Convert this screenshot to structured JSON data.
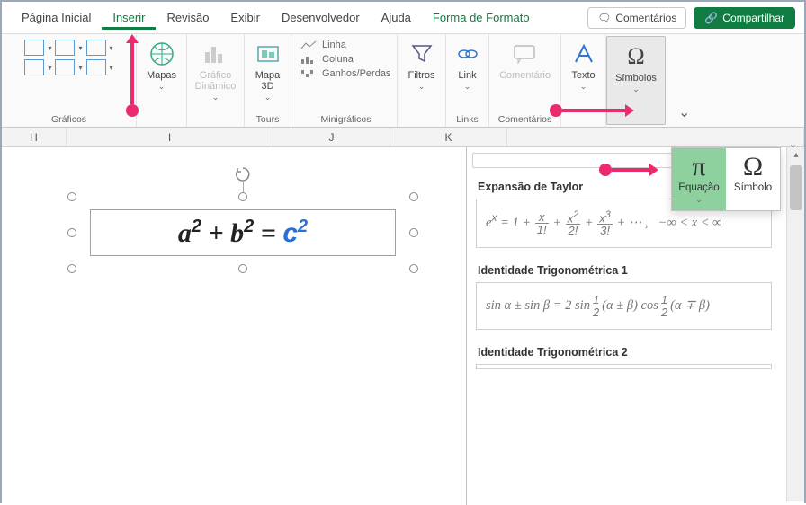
{
  "tabs": {
    "home": "Página Inicial",
    "insert": "Inserir",
    "review": "Revisão",
    "view": "Exibir",
    "developer": "Desenvolvedor",
    "help": "Ajuda",
    "format": "Forma de Formato",
    "comments_btn": "Comentários",
    "share_btn": "Compartilhar"
  },
  "ribbon": {
    "maps": "Mapas",
    "pivot_chart": "Gráfico Dinâmico",
    "map_3d": "Mapa 3D",
    "spark_line": "Linha",
    "spark_col": "Coluna",
    "spark_winloss": "Ganhos/Perdas",
    "filters": "Filtros",
    "link": "Link",
    "comment": "Comentário",
    "text": "Texto",
    "symbols": "Símbolos",
    "g_charts": "Gráficos",
    "g_tours": "Tours",
    "g_spark": "Minigráficos",
    "g_links": "Links",
    "g_comments": "Comentários"
  },
  "popover": {
    "equation": "Equação",
    "symbol": "Símbolo"
  },
  "columns": {
    "h": "H",
    "i": "I",
    "j": "J",
    "k": "K"
  },
  "gallery": {
    "taylor_title": "Expansão de Taylor",
    "trig1_title": "Identidade Trigonométrica 1",
    "trig2_title": "Identidade Trigonométrica 2"
  },
  "icons": {
    "comment_bubble": "💬",
    "share": "⇪",
    "rotate": "⟳",
    "pi": "π",
    "omega": "Ω",
    "chev": "⌄"
  }
}
